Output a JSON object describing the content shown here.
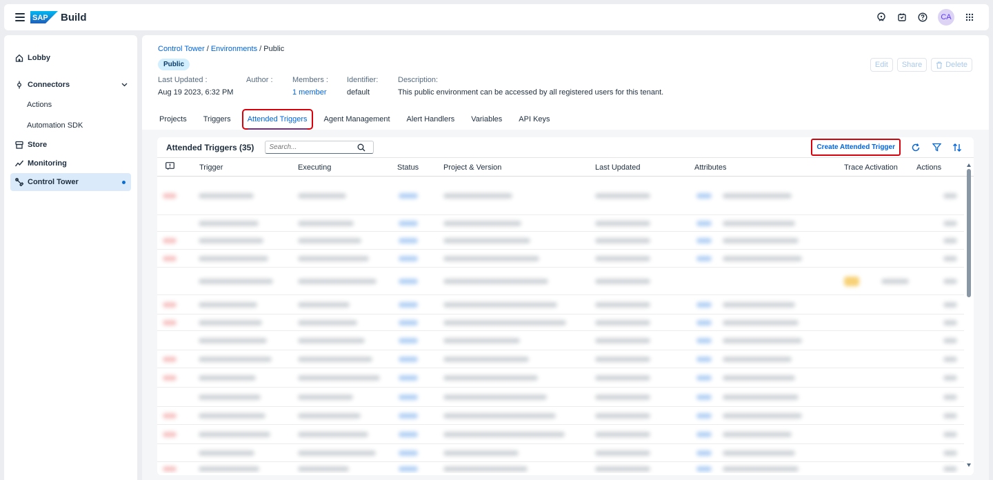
{
  "shell": {
    "brand": "Build",
    "logo_text": "SAP",
    "avatar_initials": "CA"
  },
  "sidenav": {
    "items": [
      {
        "label": "Lobby"
      },
      {
        "label": "Connectors"
      },
      {
        "label": "Actions"
      },
      {
        "label": "Automation SDK"
      },
      {
        "label": "Store"
      },
      {
        "label": "Monitoring"
      },
      {
        "label": "Control Tower"
      }
    ]
  },
  "breadcrumb": {
    "level1": "Control Tower",
    "sep": " / ",
    "level2": "Environments",
    "current": "Public"
  },
  "environment": {
    "badge": "Public",
    "last_updated_label": "Last Updated :",
    "last_updated_value": "Aug 19 2023, 6:32 PM",
    "author_label": "Author :",
    "members_label": "Members :",
    "members_value": "1 member",
    "identifier_label": "Identifier:",
    "identifier_value": "default",
    "description_label": "Description:",
    "description_value": "This public environment can be accessed by all registered users for this tenant."
  },
  "header_actions": {
    "edit": "Edit",
    "share": "Share",
    "delete": "Delete"
  },
  "tabs": [
    {
      "label": "Projects"
    },
    {
      "label": "Triggers"
    },
    {
      "label": "Attended Triggers"
    },
    {
      "label": "Agent Management"
    },
    {
      "label": "Alert Handlers"
    },
    {
      "label": "Variables"
    },
    {
      "label": "API Keys"
    }
  ],
  "table": {
    "title": "Attended Triggers (35)",
    "search_placeholder": "Search...",
    "create_label": "Create Attended Trigger",
    "columns": {
      "trigger": "Trigger",
      "executing": "Executing",
      "status": "Status",
      "project_version": "Project & Version",
      "last_updated": "Last Updated",
      "attributes": "Attributes",
      "trace_activation": "Trace Activation",
      "actions": "Actions"
    }
  },
  "colors": {
    "accent": "#0064d9",
    "highlight": "#d8000a",
    "badge_bg": "#d1efff",
    "active_nav_bg": "#dbeafb"
  },
  "icons": [
    "hamburger-icon",
    "sap-logo",
    "assistant-icon",
    "notification-icon",
    "help-icon",
    "grid-icon",
    "home-icon",
    "connectors-icon",
    "store-icon",
    "monitoring-icon",
    "control-tower-icon",
    "refresh-icon",
    "filter-icon",
    "sort-icon",
    "search-icon",
    "delete-icon"
  ]
}
